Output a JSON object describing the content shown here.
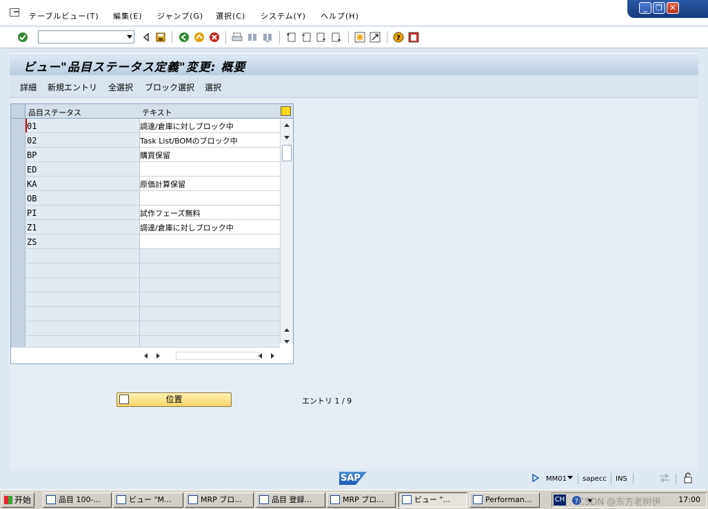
{
  "menubar": {
    "items": [
      {
        "label": "テーブルビュー(T)"
      },
      {
        "label": "編集(E)"
      },
      {
        "label": "ジャンプ(G)"
      },
      {
        "label": "選択(C)"
      },
      {
        "label": "システム(Y)"
      },
      {
        "label": "ヘルプ(H)"
      }
    ]
  },
  "toolbar": {
    "command_field_value": ""
  },
  "title": "ビュー\"品目ステータス定義\"変更: 概要",
  "app_toolbar": {
    "buttons": [
      {
        "label": "詳細"
      },
      {
        "label": "新規エントリ"
      },
      {
        "label": "全選択"
      },
      {
        "label": "ブロック選択"
      },
      {
        "label": "選択"
      }
    ]
  },
  "table": {
    "columns": [
      {
        "label": "品目ステータス"
      },
      {
        "label": "テキスト"
      }
    ],
    "rows": [
      {
        "status": "01",
        "text": "調達/倉庫に対しブロック中"
      },
      {
        "status": "02",
        "text": "Task List/BOMのブロック中"
      },
      {
        "status": "BP",
        "text": "購買保留"
      },
      {
        "status": "ED",
        "text": ""
      },
      {
        "status": "KA",
        "text": "原価計算保留"
      },
      {
        "status": "OB",
        "text": ""
      },
      {
        "status": "PI",
        "text": "試作フェーズ無料"
      },
      {
        "status": "Z1",
        "text": "調達/倉庫に対しブロック中"
      },
      {
        "status": "ZS",
        "text": ""
      }
    ]
  },
  "position_button": {
    "label": "位置"
  },
  "entries_text": "エントリ 1 / 9",
  "statusbar": {
    "transaction": "MM01",
    "system": "sapecc",
    "mode": "INS",
    "logo": "SAP"
  },
  "taskbar": {
    "start_label": "开始",
    "tasks": [
      {
        "label": "品目 100-..."
      },
      {
        "label": "ビュー \"M..."
      },
      {
        "label": "MRP ブロ..."
      },
      {
        "label": "品目 登録..."
      },
      {
        "label": "MRP ブロ..."
      },
      {
        "label": "ビュー \"..."
      },
      {
        "label": "Performan..."
      }
    ],
    "lang": "CH",
    "clock": "17:00",
    "watermark": "CSDN @东方老树伊"
  }
}
